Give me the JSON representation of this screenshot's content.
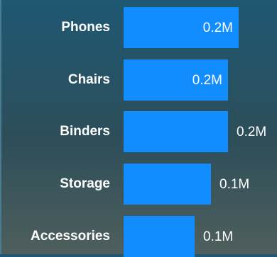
{
  "chart_data": {
    "type": "bar",
    "orientation": "horizontal",
    "categories": [
      "Phones",
      "Chairs",
      "Binders",
      "Storage",
      "Accessories"
    ],
    "values": [
      0.21,
      0.19,
      0.19,
      0.16,
      0.13
    ],
    "data_labels": [
      "0.2M",
      "0.2M",
      "0.2M",
      "0.1M",
      "0.1M"
    ],
    "label_position": [
      "inside",
      "inside",
      "outside",
      "outside",
      "outside"
    ],
    "title": "",
    "xlabel": "",
    "ylabel": "",
    "xlim": [
      0,
      0.21
    ],
    "grid": false,
    "bar_color": "#118dff"
  }
}
